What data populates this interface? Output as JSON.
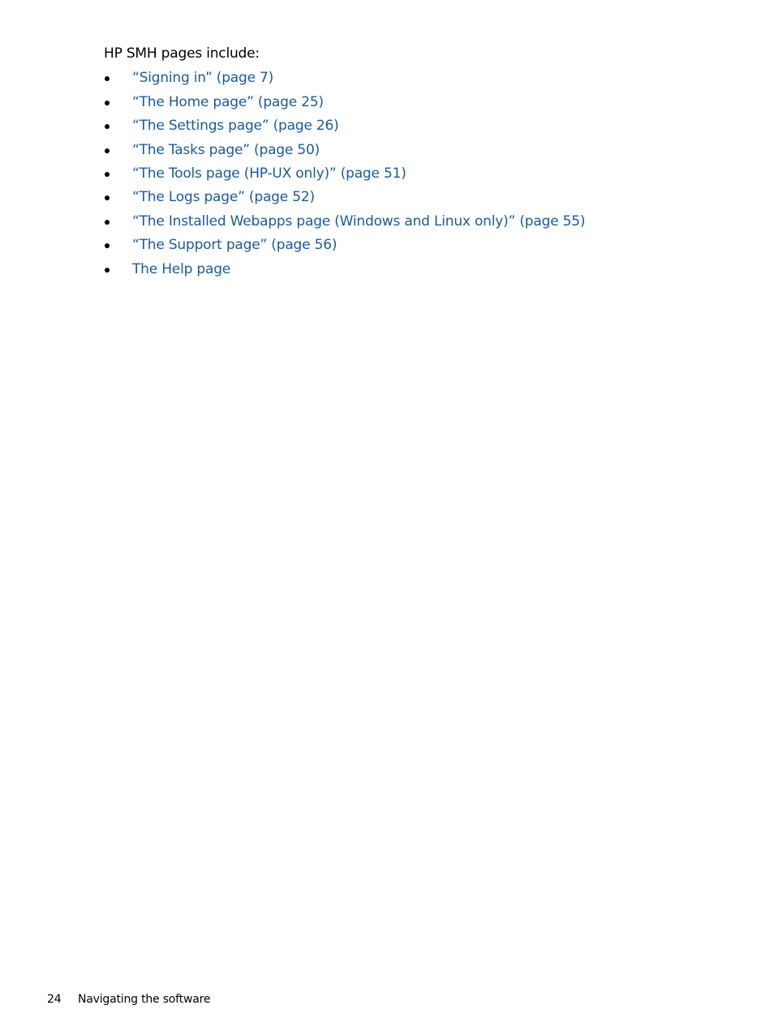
{
  "intro": "HP SMH pages include:",
  "links_color": "#1a5a9a",
  "items": [
    {
      "label": "“Signing in” (page 7)"
    },
    {
      "label": "“The Home page” (page 25)"
    },
    {
      "label": "“The Settings page” (page 26)"
    },
    {
      "label": "“The Tasks page” (page 50)"
    },
    {
      "label": "“The Tools page (HP-UX only)” (page 51)"
    },
    {
      "label": "“The Logs page” (page 52)"
    },
    {
      "label": "“The Installed Webapps page (Windows and Linux only)” (page 55)"
    },
    {
      "label": "“The Support page” (page 56)"
    },
    {
      "label": "The Help page"
    }
  ],
  "footer": {
    "page_number": "24",
    "section_title": "Navigating the software"
  }
}
